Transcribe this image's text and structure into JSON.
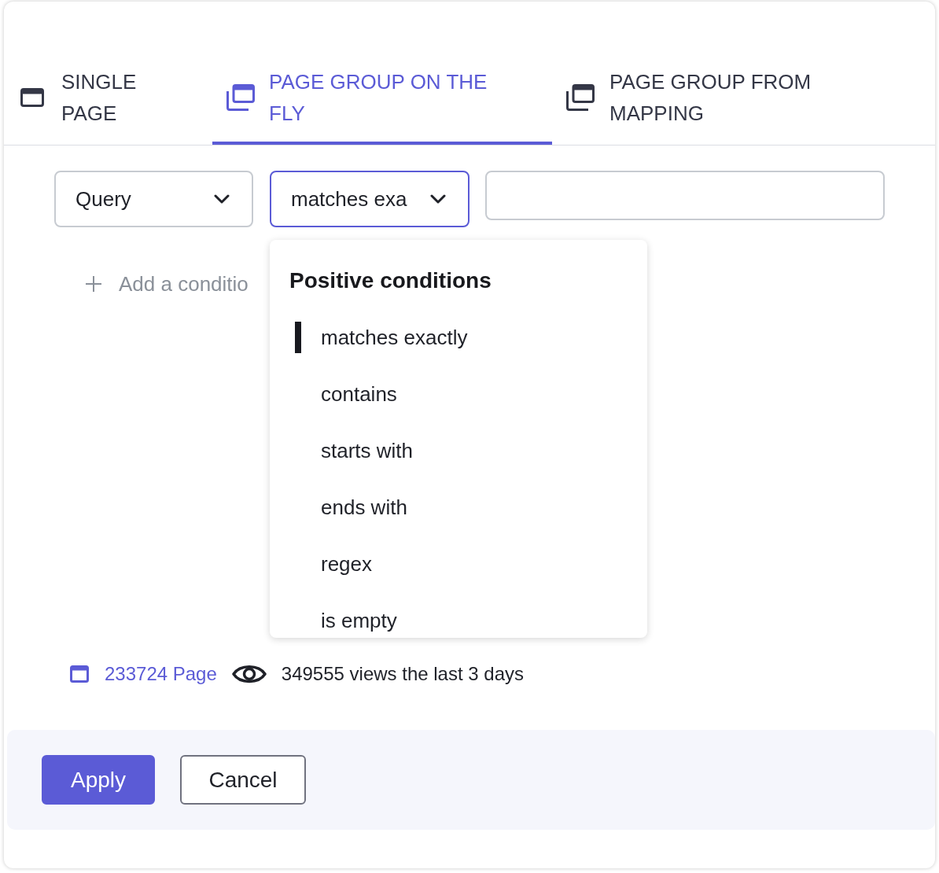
{
  "tabs": [
    {
      "label": "SINGLE PAGE",
      "kind": "single",
      "selected": false
    },
    {
      "label": "PAGE GROUP ON THE FLY",
      "kind": "stack",
      "selected": true
    },
    {
      "label": "PAGE GROUP FROM MAPPING",
      "kind": "stack",
      "selected": false
    }
  ],
  "condition": {
    "field": {
      "value": "Query",
      "focused": false
    },
    "operator": {
      "value": "matches exa",
      "focused": true
    }
  },
  "add_condition": {
    "label": "Add a conditio"
  },
  "operator_menu": {
    "heading": "Positive conditions",
    "options": [
      {
        "label": "matches exactly",
        "selected": true
      },
      {
        "label": "contains",
        "selected": false
      },
      {
        "label": "starts with",
        "selected": false
      },
      {
        "label": "ends with",
        "selected": false
      },
      {
        "label": "regex",
        "selected": false
      },
      {
        "label": "is empty",
        "selected": false
      }
    ]
  },
  "summary": {
    "pages": "233724 Page",
    "views": "349555 views the last 3 days"
  },
  "buttons": [
    {
      "label": "Apply",
      "kind": "primary"
    },
    {
      "label": "Cancel",
      "kind": "secondary"
    }
  ]
}
